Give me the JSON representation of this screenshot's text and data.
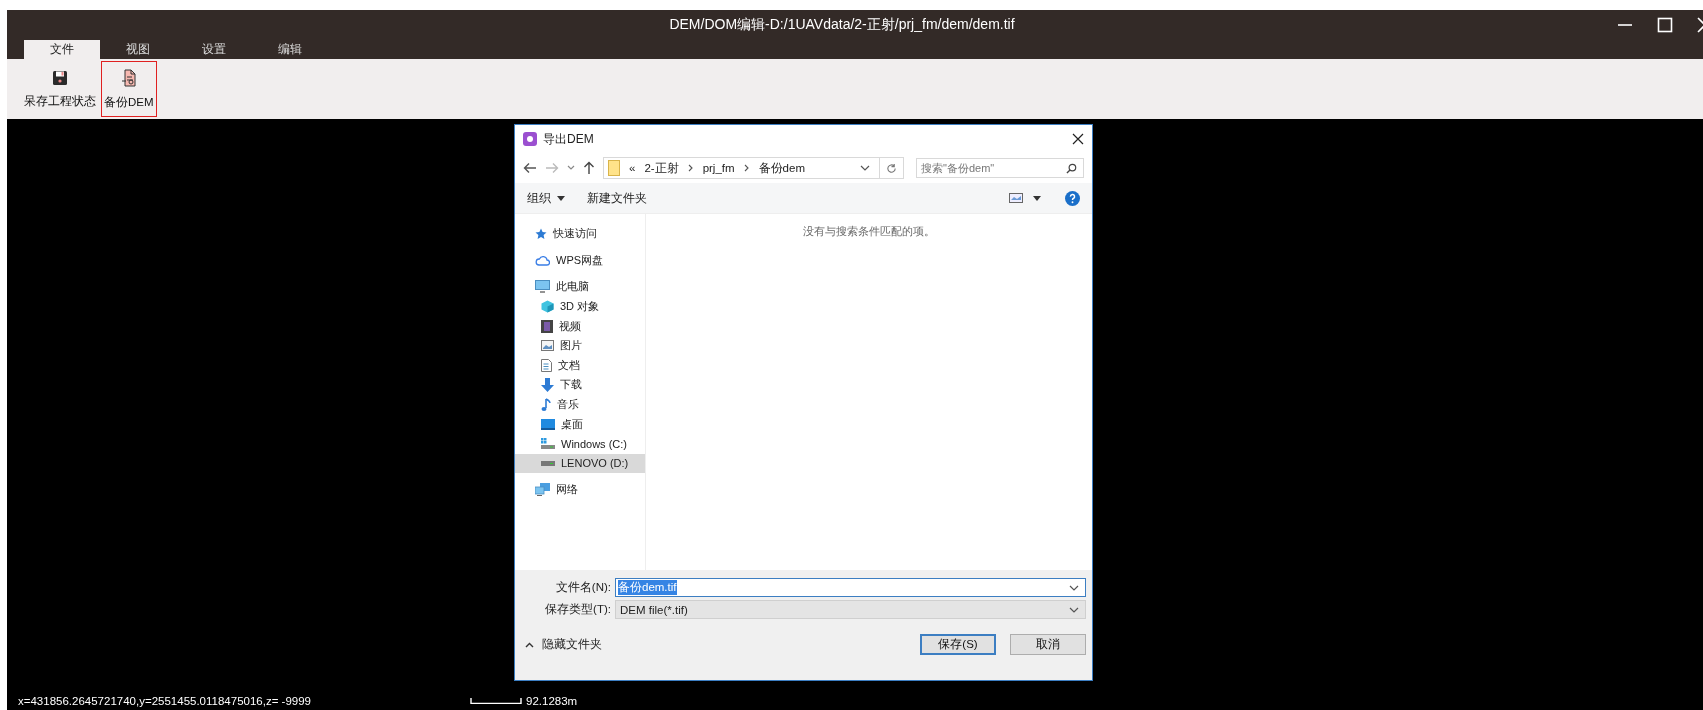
{
  "window": {
    "title": "DEM/DOM编辑-D:/1UAVdata/2-正射/prj_fm/dem/dem.tif"
  },
  "tabs": [
    {
      "label": "文件",
      "selected": true
    },
    {
      "label": "视图",
      "selected": false
    },
    {
      "label": "设置",
      "selected": false
    },
    {
      "label": "编辑",
      "selected": false
    }
  ],
  "toolbar": [
    {
      "label": "呆存工程状态",
      "kind": "save",
      "highlighted": false
    },
    {
      "label": "备份DEM",
      "kind": "document",
      "highlighted": true
    }
  ],
  "dialog": {
    "title": "导出DEM",
    "breadcrumb_prefix": "«",
    "breadcrumb": [
      "2-正射",
      "prj_fm",
      "备份dem"
    ],
    "search": {
      "placeholder": "搜索\"备份dem\""
    },
    "commands": [
      "组织",
      "新建文件夹"
    ],
    "sidebar": [
      {
        "label": "快速访问",
        "kind": "star",
        "selected": false
      },
      {
        "label": "WPS网盘",
        "kind": "cloud",
        "selected": false
      },
      {
        "label": "此电脑",
        "kind": "pc",
        "selected": false,
        "children": [
          {
            "label": "3D 对象",
            "kind": "cube",
            "selected": false
          },
          {
            "label": "视频",
            "kind": "video",
            "selected": false
          },
          {
            "label": "图片",
            "kind": "image",
            "selected": false
          },
          {
            "label": "文档",
            "kind": "doc",
            "selected": false
          },
          {
            "label": "下载",
            "kind": "download",
            "selected": false
          },
          {
            "label": "音乐",
            "kind": "music",
            "selected": false
          },
          {
            "label": "桌面",
            "kind": "desktop",
            "selected": false
          },
          {
            "label": "Windows (C:)",
            "kind": "windrive",
            "selected": false
          },
          {
            "label": "LENOVO (D:)",
            "kind": "drive",
            "selected": true
          }
        ]
      },
      {
        "label": "网络",
        "kind": "network",
        "selected": false
      }
    ],
    "empty_message": "没有与搜索条件匹配的项。",
    "filename": {
      "label": "文件名(N):",
      "value": "备份dem.tif"
    },
    "filetype": {
      "label": "保存类型(T):",
      "value": "DEM file(*.tif)"
    },
    "hide_folders": "隐藏文件夹",
    "buttons": [
      {
        "label": "保存(S)",
        "default": true
      },
      {
        "label": "取消",
        "default": false
      }
    ]
  },
  "status_bar": {
    "coordinates": "x=431856.2645721740,y=2551455.0118475016,z= -9999",
    "scale": "92.1283m"
  }
}
